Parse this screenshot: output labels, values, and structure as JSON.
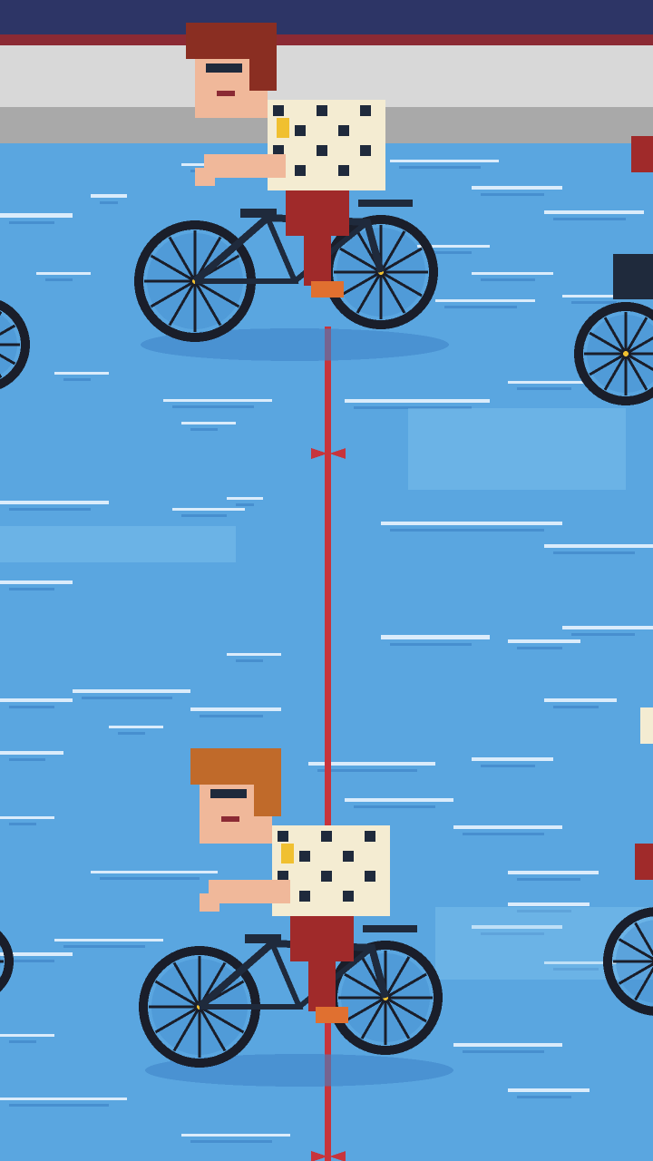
{
  "palette": {
    "sky_top": "#2d3566",
    "wall_trim": "#8b2a34",
    "wall": "#d8d8d8",
    "wall_shadow": "#a9a9a9",
    "track": "#5aa6e0",
    "track_light": "#8ccaf2",
    "track_dark": "#3f86c8",
    "streak": "#f2f8ff",
    "center_line": "#c8343c",
    "tire": "#1a1e2a",
    "spoke": "#7aa8cc",
    "frame": "#1f2a3c",
    "skin": "#f0b89a",
    "hair_red": "#8a2e22",
    "hair_orange": "#c06a2a",
    "jersey_cream": "#f4ecd2",
    "pants_red": "#a02a2a",
    "shoe_orange": "#e07030",
    "accent_yellow": "#f0c030"
  },
  "riders": [
    {
      "id": "rider-top",
      "hair": "auburn",
      "jersey": "cream-checkered"
    },
    {
      "id": "rider-bottom",
      "hair": "orange",
      "jersey": "cream-checkered"
    },
    {
      "id": "rider-edge-left",
      "visibility": "partial"
    },
    {
      "id": "rider-edge-right-upper",
      "visibility": "partial"
    },
    {
      "id": "rider-edge-right-lower",
      "visibility": "partial"
    }
  ]
}
